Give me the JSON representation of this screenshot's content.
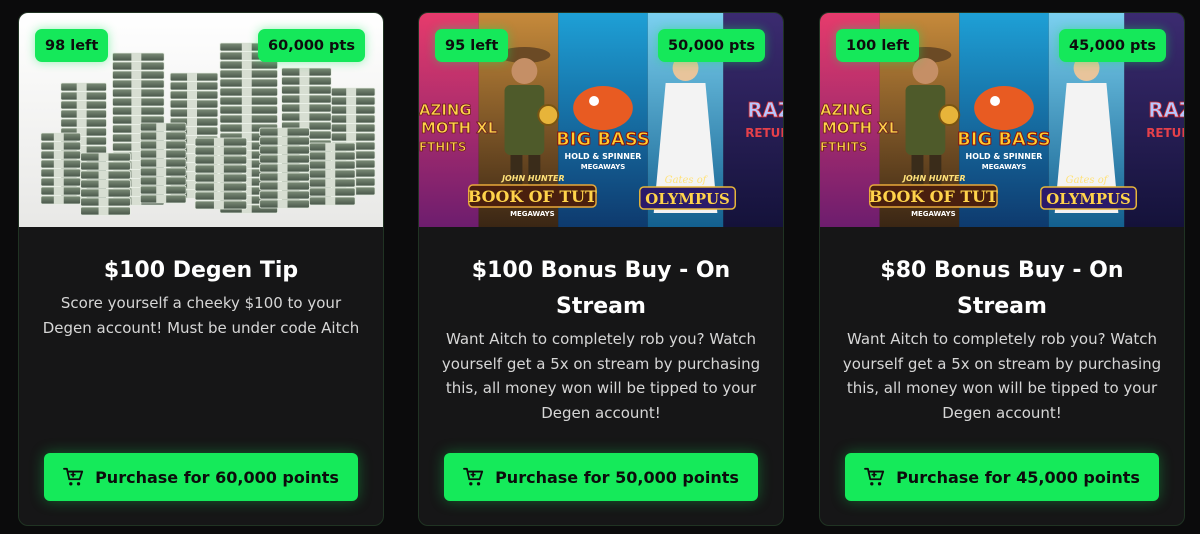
{
  "cards": [
    {
      "stock": "98 left",
      "price_badge": "60,000 pts",
      "title": "$100 Degen Tip",
      "description": "Score yourself a cheeky $100 to your Degen account! Must be under code Aitch",
      "button_label": "Purchase for 60,000 points",
      "image": "money-stacks"
    },
    {
      "stock": "95 left",
      "price_badge": "50,000 pts",
      "title": "$100 Bonus Buy - On Stream",
      "description": "Want Aitch to completely rob you? Watch yourself get a 5x on stream by purchasing this, all money won will be tipped to your Degen account!",
      "button_label": "Purchase for 50,000 points",
      "image": "slot-games-collage"
    },
    {
      "stock": "100 left",
      "price_badge": "45,000 pts",
      "title": "$80 Bonus Buy - On Stream",
      "description": "Want Aitch to completely rob you? Watch yourself get a 5x on stream by purchasing this, all money won will be tipped to your Degen account!",
      "button_label": "Purchase for 45,000 points",
      "image": "slot-games-collage"
    }
  ],
  "colors": {
    "accent": "#15e85a",
    "card_bg": "#161617",
    "page_bg": "#0b0b0c"
  },
  "icons": {
    "button": "cart-icon"
  },
  "slot_art_text": {
    "amazing_moth": "AZING\nMOTH XL\nFTHITS",
    "big_bass": "BIG BASS",
    "big_bass_sub": "HOLD & SPINNER\nMEGAWAYS",
    "book_of_tut_top": "JOHN HUNTER",
    "book_of_tut": "BOOK OF TUT",
    "book_of_tut_sub": "MEGAWAYS",
    "olympus_top": "Gates of",
    "olympus": "OLYMPUS",
    "razor": "RAZ",
    "razor_sub": "RETUR"
  }
}
